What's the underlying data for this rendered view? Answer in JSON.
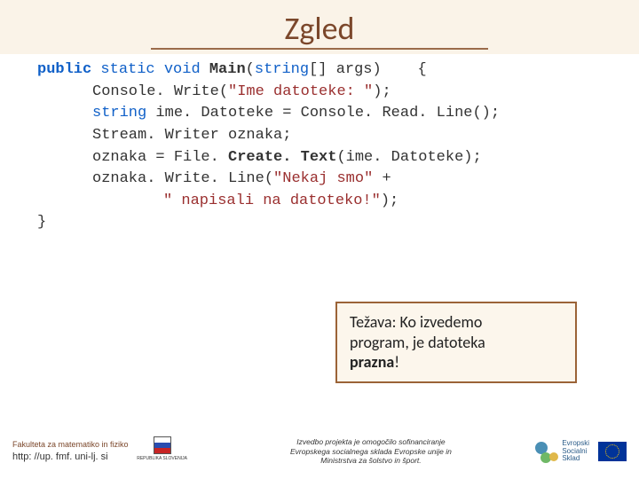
{
  "title": "Zgled",
  "code": {
    "l1_kw1": "public",
    "l1_kw2": "static",
    "l1_kw3": "void",
    "l1_fn": "Main",
    "l1_paren_open": "(",
    "l1_kw4": "string",
    "l1_rest": "[] args)",
    "l1_brace": "{",
    "l2_a": "Console. Write(",
    "l2_str": "\"Ime datoteke: \"",
    "l2_b": ");",
    "l3_kw": "string",
    "l3_rest": " ime. Datoteke = Console. Read. Line();",
    "l4": "Stream. Writer oznaka;",
    "l5_a": "oznaka = File. ",
    "l5_fn": "Create. Text",
    "l5_b": "(ime. Datoteke);",
    "l6_a": "oznaka. Write. Line(",
    "l6_str": "\"Nekaj smo\"",
    "l6_b": " +",
    "l7_str": "\" napisali na datoteko!\"",
    "l7_b": ");",
    "l8": "}"
  },
  "callout": {
    "line1a": "Težava: Ko izvedemo",
    "line2a": "program, je datoteka",
    "line3bold": "prazna",
    "line3b": "!"
  },
  "footer": {
    "fac_line1": "Fakulteta za matematiko in fiziko",
    "fac_line2": "http: //up. fmf. uni-lj. si",
    "coat_label": "REPUBLIKA SLOVENIJA",
    "financing": "Izvedbo projekta je omogočilo sofinanciranje\nEvropskega socialnega sklada Evropske unije in\nMinistrstva za šolstvo in šport.",
    "esf_line1": "Evropski",
    "esf_line2": "Socialni",
    "esf_line3": "Sklad"
  }
}
